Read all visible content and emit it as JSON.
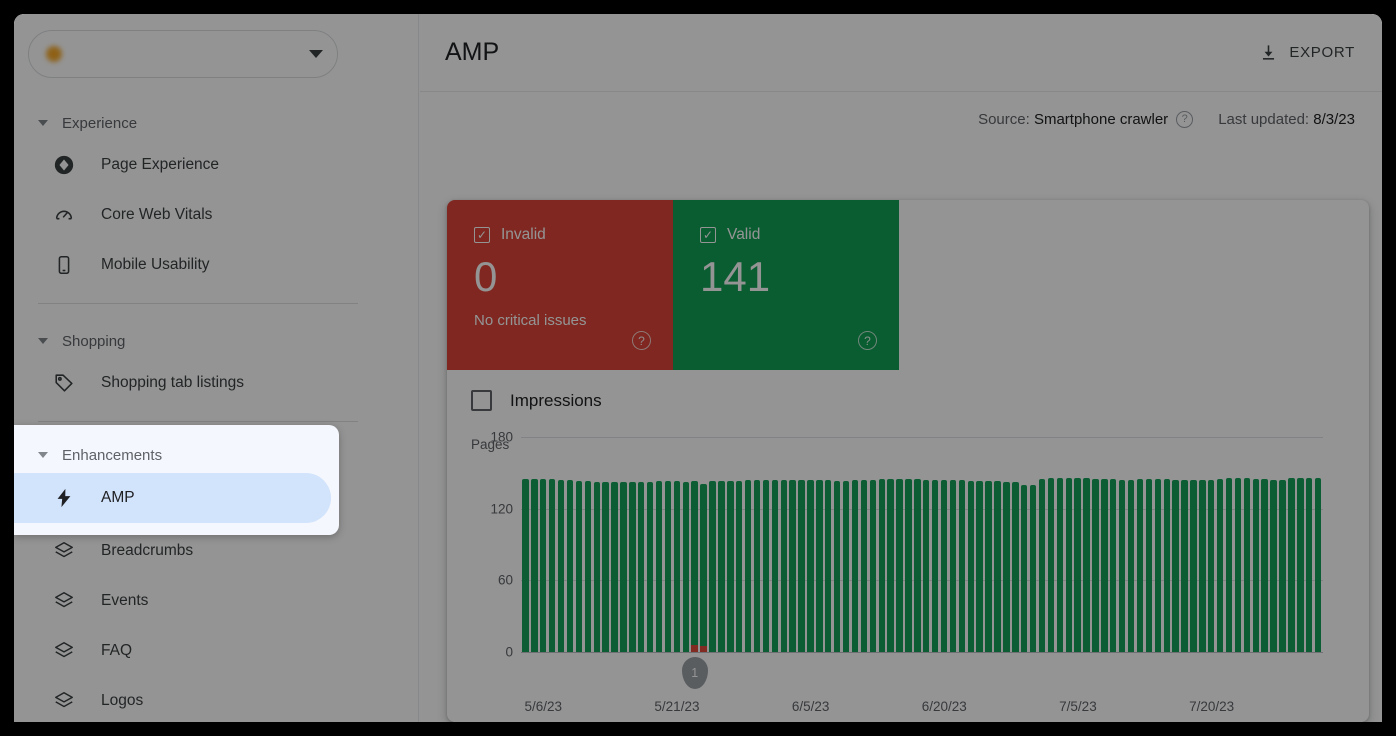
{
  "sidebar": {
    "site_picker": {
      "value": "",
      "placeholder": "",
      "caret_icon": "chevron-down-icon"
    },
    "groups": [
      {
        "label": "Experience",
        "items": [
          {
            "label": "Page Experience",
            "icon": "page-experience-icon"
          },
          {
            "label": "Core Web Vitals",
            "icon": "speedometer-icon"
          },
          {
            "label": "Mobile Usability",
            "icon": "mobile-phone-icon"
          }
        ]
      },
      {
        "label": "Shopping",
        "items": [
          {
            "label": "Shopping tab listings",
            "icon": "tag-icon"
          }
        ]
      },
      {
        "label": "Enhancements",
        "items": [
          {
            "label": "AMP",
            "icon": "lightning-bolt-icon",
            "selected": true
          },
          {
            "label": "Breadcrumbs",
            "icon": "layers-icon"
          },
          {
            "label": "Events",
            "icon": "layers-icon"
          },
          {
            "label": "FAQ",
            "icon": "layers-icon"
          },
          {
            "label": "Logos",
            "icon": "layers-icon"
          }
        ]
      }
    ]
  },
  "header": {
    "title": "AMP",
    "export_label": "EXPORT",
    "export_icon": "download-icon"
  },
  "meta": {
    "source_label": "Source:",
    "source_value": "Smartphone crawler",
    "help_icon": "help-circle-icon",
    "last_updated_label": "Last updated:",
    "last_updated_value": "8/3/23"
  },
  "tiles": [
    {
      "label": "Invalid",
      "value": "0",
      "subtext": "No critical issues",
      "color": "#db4437",
      "checked": true,
      "check_glyph": "✓",
      "help_icon": "help-circle-icon"
    },
    {
      "label": "Valid",
      "value": "141",
      "subtext": "",
      "color": "#10a055",
      "checked": true,
      "check_glyph": "✓",
      "help_icon": "help-circle-icon"
    }
  ],
  "impressions": {
    "label": "Impressions",
    "checked": false
  },
  "chart_data": {
    "type": "bar",
    "title": "",
    "ylabel": "Pages",
    "xlabel": "",
    "ylim": [
      0,
      180
    ],
    "yticks": [
      180,
      120,
      60,
      0
    ],
    "grid": true,
    "stacked": true,
    "legend_position": "none",
    "x_tick_labels": [
      "5/6/23",
      "5/21/23",
      "6/5/23",
      "6/20/23",
      "7/5/23",
      "7/20/23"
    ],
    "x_tick_indices": [
      2,
      17,
      32,
      47,
      62,
      77
    ],
    "colors": {
      "valid": "#15a05a",
      "invalid": "#e04a3b"
    },
    "annotation": {
      "label": "1",
      "index": 19,
      "color": "#9aa0a6"
    },
    "series": [
      {
        "name": "Valid",
        "values": [
          145,
          145,
          145,
          145,
          144,
          144,
          143,
          143,
          142,
          142,
          142,
          142,
          142,
          142,
          142,
          143,
          143,
          143,
          142,
          137,
          136,
          143,
          143,
          143,
          143,
          144,
          144,
          144,
          144,
          144,
          144,
          144,
          144,
          144,
          144,
          143,
          143,
          144,
          144,
          144,
          145,
          145,
          145,
          145,
          145,
          144,
          144,
          144,
          144,
          144,
          143,
          143,
          143,
          143,
          142,
          142,
          140,
          140,
          145,
          146,
          146,
          146,
          146,
          146,
          145,
          145,
          145,
          144,
          144,
          145,
          145,
          145,
          145,
          144,
          144,
          144,
          144,
          144,
          145,
          146,
          146,
          146,
          145,
          145,
          144,
          144,
          146,
          146,
          146,
          146
        ]
      },
      {
        "name": "Invalid",
        "values": [
          0,
          0,
          0,
          0,
          0,
          0,
          0,
          0,
          0,
          0,
          0,
          0,
          0,
          0,
          0,
          0,
          0,
          0,
          0,
          6,
          5,
          0,
          0,
          0,
          0,
          0,
          0,
          0,
          0,
          0,
          0,
          0,
          0,
          0,
          0,
          0,
          0,
          0,
          0,
          0,
          0,
          0,
          0,
          0,
          0,
          0,
          0,
          0,
          0,
          0,
          0,
          0,
          0,
          0,
          0,
          0,
          0,
          0,
          0,
          0,
          0,
          0,
          0,
          0,
          0,
          0,
          0,
          0,
          0,
          0,
          0,
          0,
          0,
          0,
          0,
          0,
          0,
          0,
          0,
          0,
          0,
          0,
          0,
          0,
          0,
          0,
          0,
          0,
          0,
          0
        ]
      }
    ]
  }
}
